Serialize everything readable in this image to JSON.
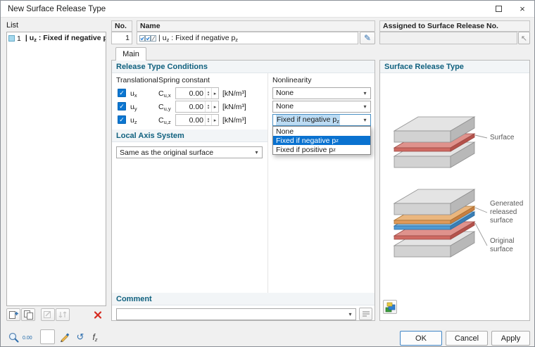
{
  "window": {
    "title": "New Surface Release Type"
  },
  "icons": {
    "close": "×",
    "check": "✓",
    "chevron": "▾",
    "pencil": "✎",
    "pick": "↖",
    "spin_up": "▴",
    "spin_down": "▾",
    "unit_arrow": "▸",
    "undo": "↺",
    "decimals": "0.00",
    "func": "f",
    "func_sub": "z"
  },
  "list_panel": {
    "label": "List",
    "item": {
      "no": "1",
      "pipe": "|",
      "dof": "u",
      "dof_sub": "z",
      "text": " : Fixed if negative p",
      "text_sub": "z"
    }
  },
  "header": {
    "no_label": "No.",
    "no_value": "1",
    "name_label": "Name",
    "assigned_label": "Assigned to Surface Release No.",
    "assigned_value": ""
  },
  "name_value": {
    "pipe": "|",
    "dof": "u",
    "dof_sub": "z",
    "text": " : Fixed if negative p",
    "text_sub": "z"
  },
  "tabs": {
    "main": "Main"
  },
  "conditions": {
    "header": "Release Type Conditions",
    "col_translational": "Translational",
    "col_spring": "Spring constant",
    "col_nonlinearity": "Nonlinearity",
    "rows": [
      {
        "dof": "u",
        "dof_sub": "x",
        "c": "C",
        "c_sub": "u,x",
        "value": "0.00",
        "unit": "[kN/m³]",
        "nl": "None",
        "nl_sub": ""
      },
      {
        "dof": "u",
        "dof_sub": "y",
        "c": "C",
        "c_sub": "u,y",
        "value": "0.00",
        "unit": "[kN/m³]",
        "nl": "None",
        "nl_sub": ""
      },
      {
        "dof": "u",
        "dof_sub": "z",
        "c": "C",
        "c_sub": "u,z",
        "value": "0.00",
        "unit": "[kN/m³]",
        "nl": "Fixed if negative p",
        "nl_sub": "z"
      }
    ],
    "dropdown": {
      "items": [
        {
          "text": "None",
          "sub": ""
        },
        {
          "text": "Fixed if negative p",
          "sub": "z"
        },
        {
          "text": "Fixed if positive p",
          "sub": "z"
        }
      ]
    }
  },
  "local_axis": {
    "header": "Local Axis System",
    "value": "Same as the original surface"
  },
  "comment": {
    "header": "Comment",
    "value": ""
  },
  "preview": {
    "header": "Surface Release Type",
    "label_surface": "Surface",
    "label_generated": "Generated released surface",
    "label_original": "Original surface"
  },
  "footer": {
    "ok": "OK",
    "cancel": "Cancel",
    "apply": "Apply"
  }
}
